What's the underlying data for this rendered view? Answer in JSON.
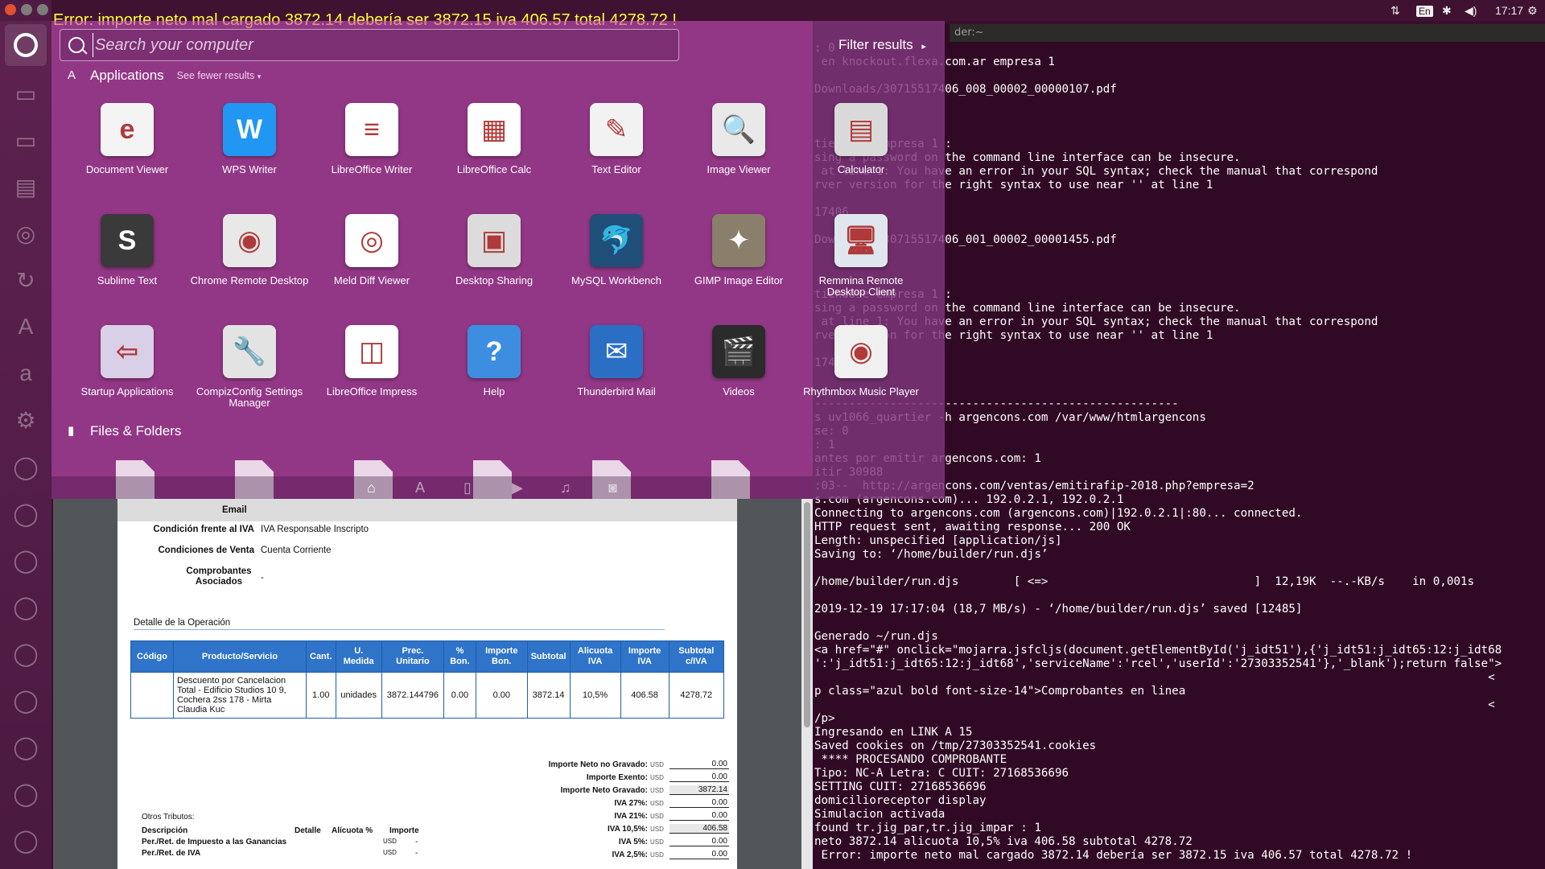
{
  "top_panel": {
    "error_banner": "Error: importe neto mal cargado 3872.14 debería ser 3872.15 iva 406.57 total 4278.72 !",
    "keyboard_layout": "En",
    "clock": "17:17"
  },
  "dash": {
    "search_placeholder": "Search your computer",
    "filter_results_label": "Filter results",
    "applications_heading": "Applications",
    "see_fewer_label": "See fewer results",
    "files_heading": "Files & Folders",
    "apps": [
      {
        "label": "Document Viewer",
        "icon": "document-viewer-icon",
        "color": "#f4f4f4",
        "glyph": "e"
      },
      {
        "label": "WPS Writer",
        "icon": "wps-writer-icon",
        "color": "#2196f3",
        "glyph": "W"
      },
      {
        "label": "LibreOffice Writer",
        "icon": "writer-icon",
        "color": "#ffffff",
        "glyph": "≡"
      },
      {
        "label": "LibreOffice Calc",
        "icon": "calc-icon",
        "color": "#ffffff",
        "glyph": "▦"
      },
      {
        "label": "Text Editor",
        "icon": "text-editor-icon",
        "color": "#f2f2f2",
        "glyph": "✎"
      },
      {
        "label": "Image Viewer",
        "icon": "image-viewer-icon",
        "color": "#e9e9e9",
        "glyph": "🔍"
      },
      {
        "label": "Calculator",
        "icon": "calculator-icon",
        "color": "#d9d9d9",
        "glyph": "▤"
      },
      {
        "label": "Sublime Text",
        "icon": "sublime-text-icon",
        "color": "#3a3a3a",
        "glyph": "S"
      },
      {
        "label": "Chrome Remote Desktop",
        "icon": "chrome-remote-desktop-icon",
        "color": "#e8e8e8",
        "glyph": "◉"
      },
      {
        "label": "Meld Diff Viewer",
        "icon": "meld-icon",
        "color": "#ffffff",
        "glyph": "◎"
      },
      {
        "label": "Desktop Sharing",
        "icon": "desktop-sharing-icon",
        "color": "#dcdcdc",
        "glyph": "▣"
      },
      {
        "label": "MySQL Workbench",
        "icon": "mysql-workbench-icon",
        "color": "#1f4e79",
        "glyph": "🐬"
      },
      {
        "label": "GIMP Image Editor",
        "icon": "gimp-icon",
        "color": "#8a7f6a",
        "glyph": "✦"
      },
      {
        "label": "Remmina Remote Desktop Client",
        "icon": "remmina-icon",
        "color": "#dfe6ee",
        "glyph": "🖥"
      },
      {
        "label": "Startup Applications",
        "icon": "startup-applications-icon",
        "color": "#d9cfe6",
        "glyph": "⇦"
      },
      {
        "label": "CompizConfig Settings Manager",
        "icon": "compizconfig-icon",
        "color": "#e3e3e3",
        "glyph": "🔧"
      },
      {
        "label": "LibreOffice Impress",
        "icon": "impress-icon",
        "color": "#ffffff",
        "glyph": "◫"
      },
      {
        "label": "Help",
        "icon": "help-icon",
        "color": "#3d8ee0",
        "glyph": "?"
      },
      {
        "label": "Thunderbird Mail",
        "icon": "thunderbird-icon",
        "color": "#2a6fc4",
        "glyph": "✉"
      },
      {
        "label": "Videos",
        "icon": "videos-icon",
        "color": "#2b2b2b",
        "glyph": "🎬"
      },
      {
        "label": "Rhythmbox Music Player",
        "icon": "rhythmbox-icon",
        "color": "#f0f0f0",
        "glyph": "◉"
      }
    ]
  },
  "pdf": {
    "email_label": "Email",
    "condicion_iva_label": "Condición frente al IVA",
    "condicion_iva_value": "IVA Responsable Inscripto",
    "condiciones_venta_label": "Condiciones de Venta",
    "condiciones_venta_value": "Cuenta Corriente",
    "comprobantes_asociados_label": "Comprobantes Asociados",
    "comprobantes_asociados_value": "-",
    "detalle_heading": "Detalle de la Operación",
    "columns": [
      "Código",
      "Producto/Servicio",
      "Cant.",
      "U. Medida",
      "Prec. Unitario",
      "% Bon.",
      "Importe Bon.",
      "Subtotal",
      "Alicuota IVA",
      "Importe IVA",
      "Subtotal c/IVA"
    ],
    "row": {
      "codigo": "",
      "producto": "Descuento por Cancelacion Total - Edificio Studios 10 9, Cochera 2ss 178 - Mirta Claudia Kuc",
      "cant": "1.00",
      "umedida": "unidades",
      "prec_unitario": "3872.144796",
      "bon_pct": "0.00",
      "importe_bon": "0.00",
      "subtotal": "3872.14",
      "alicuota": "10,5%",
      "importe_iva": "406.58",
      "subtotal_civa": "4278.72"
    },
    "currency": "USD",
    "totals": [
      {
        "label": "Importe Neto no Gravado:",
        "value": "0.00"
      },
      {
        "label": "Importe Exento:",
        "value": "0.00"
      },
      {
        "label": "Importe Neto Gravado:",
        "value": "3872.14"
      },
      {
        "label": "IVA 27%:",
        "value": "0.00"
      },
      {
        "label": "IVA 21%:",
        "value": "0.00"
      },
      {
        "label": "IVA 10,5%:",
        "value": "406.58"
      },
      {
        "label": "IVA 5%:",
        "value": "0.00"
      },
      {
        "label": "IVA 2,5%:",
        "value": "0.00"
      }
    ],
    "otros_tributos": "Otros Tributos:",
    "otros_cols": [
      "Descripción",
      "Detalle",
      "Alícuota %",
      "Importe"
    ],
    "otros_rows": [
      {
        "desc": "Per./Ret. de Impuesto a las Ganancias",
        "cur": "USD",
        "importe": "-"
      },
      {
        "desc": "Per./Ret. de IVA",
        "cur": "USD",
        "importe": "-"
      }
    ]
  },
  "terminal": {
    "title": "der:~",
    "lines": [
      ": 0",
      " en knockout.flexa.com.ar empresa 1",
      "",
      "Downloads/30715517406_008_00002_00000107.pdf",
      "",
      "",
      "",
      "tiendose empresa 1 :",
      "sing a password on the command line interface can be insecure.",
      " at line 1: You have an error in your SQL syntax; check the manual that correspond",
      "rver version for the right syntax to use near '' at line 1",
      "",
      "17406",
      "",
      "Downloads/30715517406_001_00002_00001455.pdf",
      "",
      "",
      "",
      "tiendose empresa 1 :",
      "sing a password on the command line interface can be insecure.",
      " at line 1: You have an error in your SQL syntax; check the manual that correspond",
      "rver version for the right syntax to use near '' at line 1",
      "",
      "17406",
      "",
      "",
      "-----------------------------------------------------",
      "s uv1066_quartier -h argencons.com /var/www/htmlargencons",
      "se: 0",
      ": 1",
      "antes por emitir argencons.com: 1",
      "itir 30988",
      ":03--  http://argencons.com/ventas/emitirafip-2018.php?empresa=2",
      "s.com (argencons.com)... 192.0.2.1, 192.0.2.1",
      "Connecting to argencons.com (argencons.com)|192.0.2.1|:80... connected.",
      "HTTP request sent, awaiting response... 200 OK",
      "Length: unspecified [application/js]",
      "Saving to: ‘/home/builder/run.djs’",
      "",
      "/home/builder/run.djs        [ <=>                              ]  12,19K  --.-KB/s    in 0,001s",
      "",
      "2019-12-19 17:17:04 (18,7 MB/s) - ‘/home/builder/run.djs’ saved [12485]",
      "",
      "Generado ~/run.djs",
      "<a href=\"#\" onclick=\"mojarra.jsfcljs(document.getElementById('j_idt51'),{'j_idt51:j_idt65:12:j_idt68",
      "':'j_idt51:j_idt65:12:j_idt68','serviceName':'rcel','userId':'27303352541'},'_blank');return false\">",
      "                                                                                                  <",
      "p class=\"azul bold font-size-14\">Comprobantes en linea",
      "                                                                                                  <",
      "/p>",
      "Ingresando en LINK A 15",
      "Saved cookies on /tmp/27303352541.cookies",
      " **** PROCESANDO COMPROBANTE",
      "Tipo: NC-A Letra: C CUIT: 27168536696",
      "SETTING CUIT: 27168536696",
      "domicilioreceptor display",
      "Simulacion activada",
      "found tr.jig_par,tr.jig_impar : 1",
      "neto 3872.14 alicuota 10,5% iva 406.58 subtotal 4278.72",
      " Error: importe neto mal cargado 3872.14 debería ser 3872.15 iva 406.57 total 4278.72 !"
    ]
  }
}
